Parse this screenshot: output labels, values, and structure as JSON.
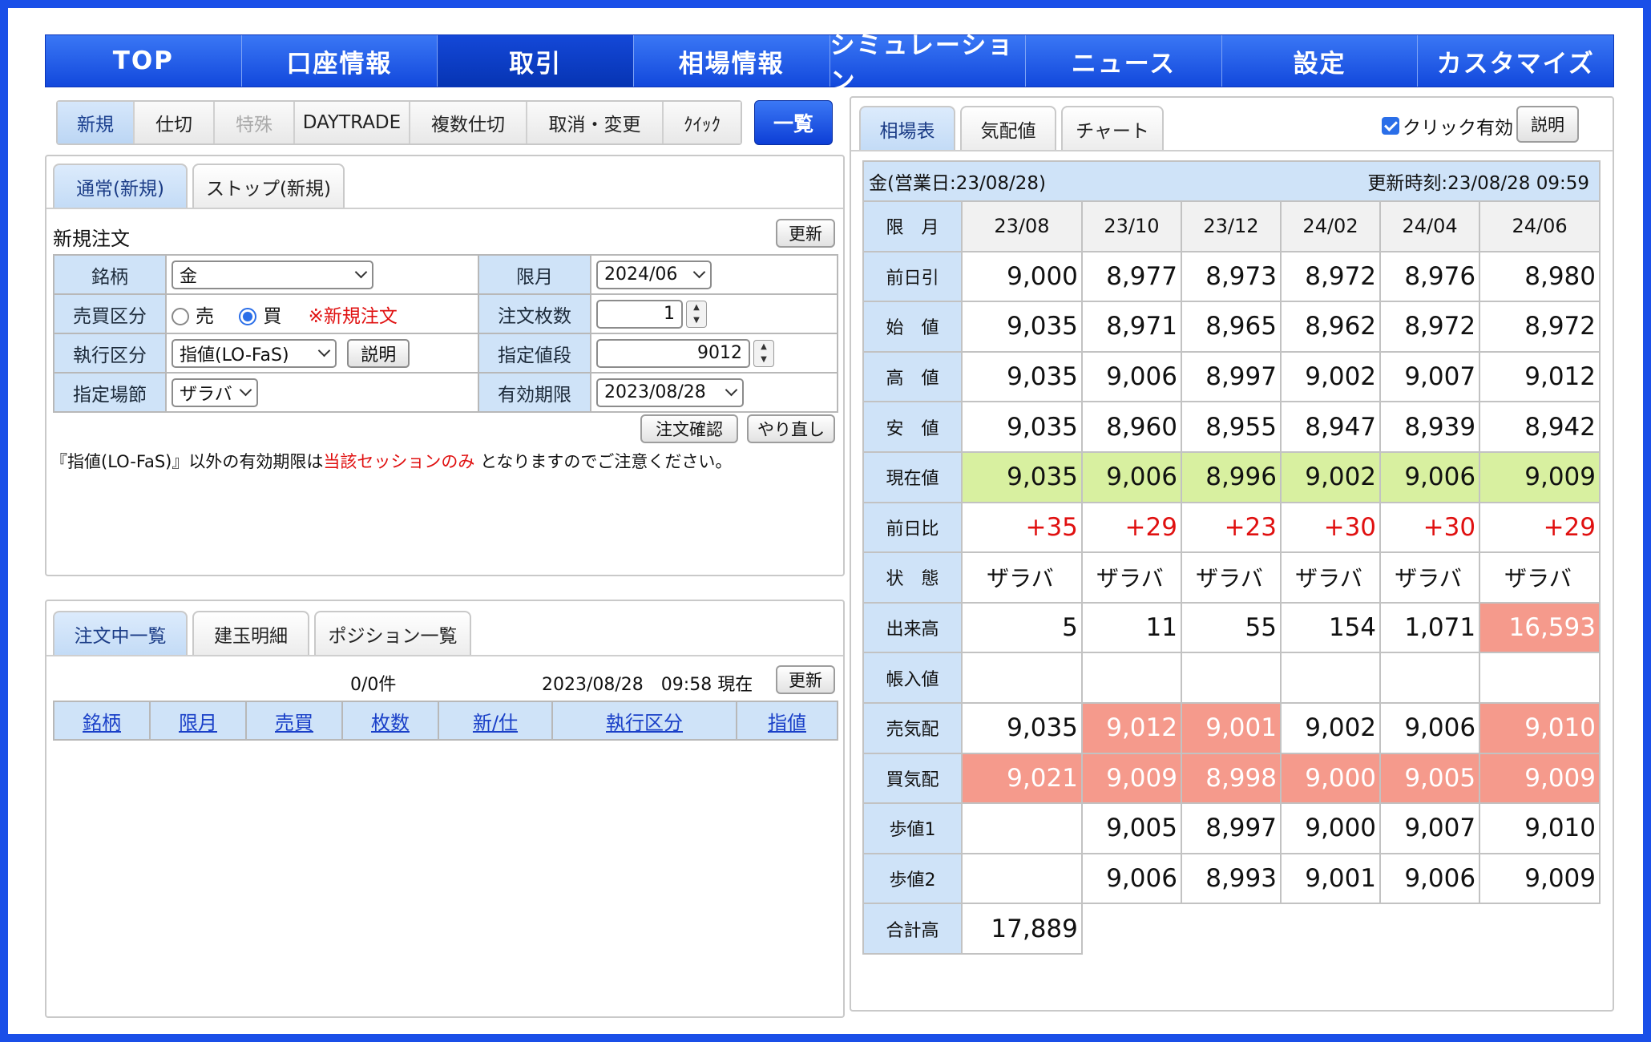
{
  "nav": [
    "TOP",
    "口座情報",
    "取引",
    "相場情報",
    "シミュレーション",
    "ニュース",
    "設定",
    "カスタマイズ"
  ],
  "subtabs": [
    "新規",
    "仕切",
    "特殊",
    "DAYTRADE",
    "複数仕切",
    "取消・変更",
    "ｸｲｯｸ"
  ],
  "ichiran": "一覧",
  "order_tabs": [
    "通常(新規)",
    "ストップ(新規)"
  ],
  "form": {
    "title": "新規注文",
    "refresh": "更新",
    "labels": {
      "meigara": "銘柄",
      "gengetsu": "限月",
      "baibai": "売買区分",
      "maisu": "注文枚数",
      "shikko": "執行区分",
      "nedan": "指定値段",
      "basetsu": "指定場節",
      "kigen": "有効期限"
    },
    "meigara_value": "金",
    "gengetsu_value": "2024/06",
    "sell": "売",
    "buy": "買",
    "new_note": "※新規注文",
    "maisu_value": "1",
    "shikko_value": "指値(LO-FaS)",
    "setsumei": "説明",
    "nedan_value": "9012",
    "basetsu_value": "ザラバ",
    "kigen_value": "2023/08/28",
    "confirm": "注文確認",
    "redo": "やり直し",
    "notice_a": "『指値(LO-FaS)』以外の有効期限は",
    "notice_b": "当該セッションのみ",
    "notice_c": " となりますのでご注意ください。"
  },
  "list_tabs": [
    "注文中一覧",
    "建玉明細",
    "ポジション一覧"
  ],
  "list": {
    "count": "0/0件",
    "datetime": "2023/08/28　09:58 現在",
    "refresh": "更新",
    "headers": [
      "銘柄",
      "限月",
      "売買",
      "枚数",
      "新/仕",
      "執行区分",
      "指値"
    ]
  },
  "market": {
    "tabs": [
      "相場表",
      "気配値",
      "チャート"
    ],
    "click_enabled": "クリック有効",
    "setsumei": "説明",
    "product": "金(営業日:23/08/28)",
    "updated": "更新時刻:23/08/28 09:59",
    "header_label": "限　月",
    "months": [
      "23/08",
      "23/10",
      "23/12",
      "24/02",
      "24/04",
      "24/06"
    ],
    "rows": [
      {
        "label": "前日引",
        "values": [
          "9,000",
          "8,977",
          "8,973",
          "8,972",
          "8,976",
          "8,980"
        ]
      },
      {
        "label": "始　値",
        "values": [
          "9,035",
          "8,971",
          "8,965",
          "8,962",
          "8,972",
          "8,972"
        ]
      },
      {
        "label": "高　値",
        "values": [
          "9,035",
          "9,006",
          "8,997",
          "9,002",
          "9,007",
          "9,012"
        ]
      },
      {
        "label": "安　値",
        "values": [
          "9,035",
          "8,960",
          "8,955",
          "8,947",
          "8,939",
          "8,942"
        ]
      },
      {
        "label": "現在値",
        "values": [
          "9,035",
          "9,006",
          "8,996",
          "9,002",
          "9,006",
          "9,009"
        ]
      },
      {
        "label": "前日比",
        "values": [
          "+35",
          "+29",
          "+23",
          "+30",
          "+30",
          "+29"
        ]
      },
      {
        "label": "状　態",
        "values": [
          "ザラバ",
          "ザラバ",
          "ザラバ",
          "ザラバ",
          "ザラバ",
          "ザラバ"
        ]
      },
      {
        "label": "出来高",
        "values": [
          "5",
          "11",
          "55",
          "154",
          "1,071",
          "16,593"
        ]
      },
      {
        "label": "帳入値",
        "values": [
          "",
          "",
          "",
          "",
          "",
          ""
        ]
      },
      {
        "label": "売気配",
        "values": [
          "9,035",
          "9,012",
          "9,001",
          "9,002",
          "9,006",
          "9,010"
        ]
      },
      {
        "label": "買気配",
        "values": [
          "9,021",
          "9,009",
          "8,998",
          "9,000",
          "9,005",
          "9,009"
        ]
      },
      {
        "label": "歩値1",
        "values": [
          "",
          "9,005",
          "8,997",
          "9,000",
          "9,007",
          "9,010"
        ]
      },
      {
        "label": "歩値2",
        "values": [
          "",
          "9,006",
          "8,993",
          "9,001",
          "9,006",
          "9,009"
        ]
      }
    ],
    "total_label": "合計高",
    "total_value": "17,889",
    "colors": {
      "current_bg": "#d8f0a0",
      "highlight_bg": "#f59a8c",
      "up_text": "#e01010"
    }
  }
}
